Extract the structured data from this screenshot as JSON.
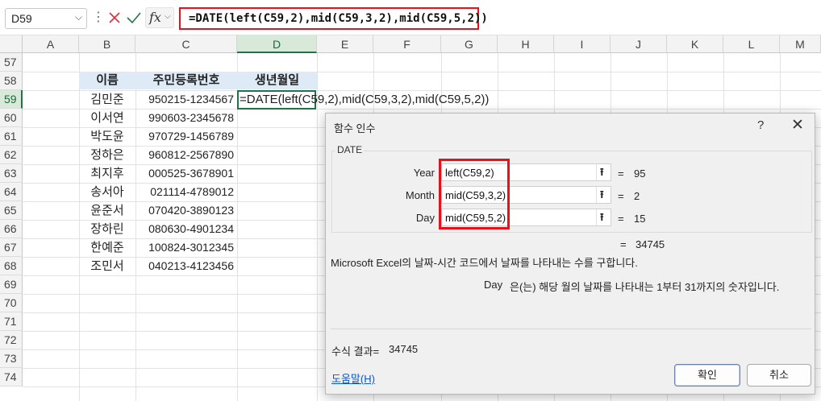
{
  "formula_bar": {
    "name_box": "D59",
    "name_box_arrow": "⌵",
    "dots": "⋮",
    "fx_label": "fx",
    "fx_arrow": "⌵",
    "formula": "=DATE(left(C59,2),mid(C59,3,2),mid(C59,5,2))"
  },
  "columns": [
    "A",
    "B",
    "C",
    "D",
    "E",
    "F",
    "G",
    "H",
    "I",
    "J",
    "K",
    "L",
    "M"
  ],
  "rows": [
    "57",
    "58",
    "59",
    "60",
    "61",
    "62",
    "63",
    "64",
    "65",
    "66",
    "67",
    "68",
    "69",
    "70",
    "71",
    "72",
    "73",
    "74"
  ],
  "table": {
    "header_name": "이름",
    "header_rrn": "주민등록번호",
    "header_birth": "생년월일",
    "active_formula": "=DATE(left(C59,2),mid(C59,3,2),mid(C59,5,2))",
    "records": [
      {
        "name": "김민준",
        "rrn": "950215-1234567"
      },
      {
        "name": "이서연",
        "rrn": "990603-2345678"
      },
      {
        "name": "박도윤",
        "rrn": "970729-1456789"
      },
      {
        "name": "정하은",
        "rrn": "960812-2567890"
      },
      {
        "name": "최지후",
        "rrn": "000525-3678901"
      },
      {
        "name": "송서아",
        "rrn": "021114-4789012"
      },
      {
        "name": "윤준서",
        "rrn": "070420-3890123"
      },
      {
        "name": "장하린",
        "rrn": "080630-4901234"
      },
      {
        "name": "한예준",
        "rrn": "100824-3012345"
      },
      {
        "name": "조민서",
        "rrn": "040213-4123456"
      }
    ]
  },
  "dialog": {
    "title": "함수 인수",
    "help_symbol": "?",
    "close_symbol": "✕",
    "function_name": "DATE",
    "arguments": [
      {
        "label": "Year",
        "value": "left(C59,2)",
        "eq": "=",
        "result": "95"
      },
      {
        "label": "Month",
        "value": "mid(C59,3,2)",
        "eq": "=",
        "result": "2"
      },
      {
        "label": "Day",
        "value": "mid(C59,5,2)",
        "eq": "=",
        "result": "15"
      }
    ],
    "total_eq": "=",
    "total_value": "34745",
    "description": "Microsoft Excel의 날짜-시간 코드에서 날짜를 나타내는 수를 구합니다.",
    "arg_desc_name": "Day",
    "arg_desc": "은(는) 해당 월의 날짜를 나타내는 1부터 31까지의 숫자입니다.",
    "result_label": "수식 결과=",
    "result_value": "34745",
    "help_link": "도움말(H)",
    "ok_label": "확인",
    "cancel_label": "취소"
  }
}
